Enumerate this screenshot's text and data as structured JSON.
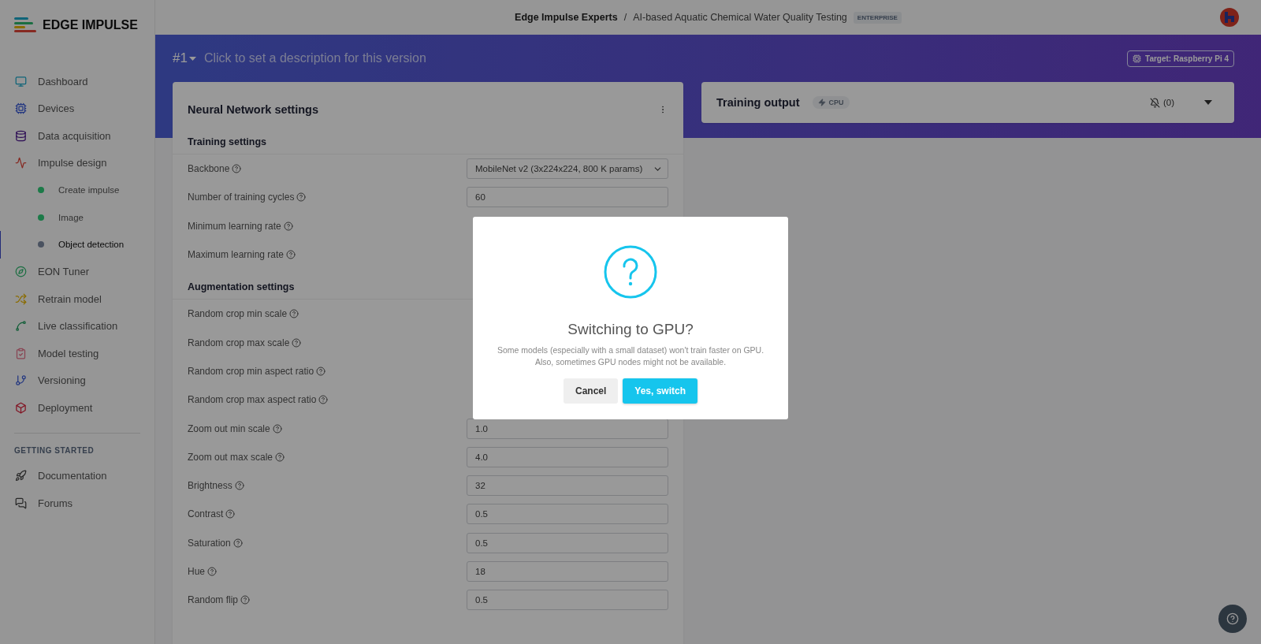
{
  "sidebar": {
    "logo": "EDGE IMPULSE",
    "items": [
      {
        "kind": "item",
        "label": "Dashboard",
        "selected": false
      },
      {
        "kind": "item",
        "label": "Devices",
        "selected": false
      },
      {
        "kind": "item",
        "label": "Data acquisition",
        "selected": false
      },
      {
        "kind": "item",
        "label": "Impulse design",
        "selected": false
      },
      {
        "kind": "sub",
        "label": "Create impulse",
        "selected": false,
        "color": "#1c7a48"
      },
      {
        "kind": "sub",
        "label": "Image",
        "selected": false,
        "color": "#1c7a48"
      },
      {
        "kind": "sub",
        "label": "Object detection",
        "selected": true,
        "color": "#4a5260"
      },
      {
        "kind": "item",
        "label": "EON Tuner",
        "selected": false
      },
      {
        "kind": "item",
        "label": "Retrain model",
        "selected": false
      },
      {
        "kind": "item",
        "label": "Live classification",
        "selected": false
      },
      {
        "kind": "item",
        "label": "Model testing",
        "selected": false
      },
      {
        "kind": "item",
        "label": "Versioning",
        "selected": false
      },
      {
        "kind": "item",
        "label": "Deployment",
        "selected": false
      }
    ],
    "section": "GETTING STARTED",
    "links": [
      {
        "label": "Documentation"
      },
      {
        "label": "Forums"
      }
    ]
  },
  "topbar": {
    "organization": "Edge Impulse Experts",
    "separator": "/",
    "project": "AI-based Aquatic Chemical Water Quality Testing",
    "badge": "ENTERPRISE"
  },
  "version": {
    "number": "#1",
    "description": "Click to set a description for this version",
    "target": "Target: Raspberry Pi 4"
  },
  "settings_card": {
    "title": "Neural Network settings",
    "sections": [
      {
        "title": "Training settings",
        "rows": [
          {
            "label": "Backbone",
            "kind": "select",
            "value": "MobileNet v2 (3x224x224, 800 K params)"
          },
          {
            "label": "Number of training cycles",
            "kind": "input",
            "value": "60"
          },
          {
            "label": "Minimum learning rate",
            "kind": "hidden"
          },
          {
            "label": "Maximum learning rate",
            "kind": "hidden"
          }
        ]
      },
      {
        "title": "Augmentation settings",
        "rows": [
          {
            "label": "Random crop min scale",
            "kind": "hidden"
          },
          {
            "label": "Random crop max scale",
            "kind": "hidden"
          },
          {
            "label": "Random crop min aspect ratio",
            "kind": "hidden"
          },
          {
            "label": "Random crop max aspect ratio",
            "kind": "hidden"
          },
          {
            "label": "Zoom out min scale",
            "kind": "input",
            "value": "1.0"
          },
          {
            "label": "Zoom out max scale",
            "kind": "input",
            "value": "4.0"
          },
          {
            "label": "Brightness",
            "kind": "input",
            "value": "32"
          },
          {
            "label": "Contrast",
            "kind": "input",
            "value": "0.5"
          },
          {
            "label": "Saturation",
            "kind": "input",
            "value": "0.5"
          },
          {
            "label": "Hue",
            "kind": "input",
            "value": "18"
          },
          {
            "label": "Random flip",
            "kind": "input",
            "value": "0.5"
          }
        ]
      }
    ]
  },
  "output_card": {
    "title": "Training output",
    "badge": "CPU",
    "notifications": "(0)"
  },
  "dialog": {
    "title": "Switching to GPU?",
    "message": "Some models (especially with a small dataset) won't train faster on GPU.\nAlso, sometimes GPU nodes might not be available.",
    "buttons": [
      {
        "kind": "secondary",
        "label": "Cancel"
      },
      {
        "kind": "primary",
        "label": "Yes, switch"
      }
    ]
  }
}
